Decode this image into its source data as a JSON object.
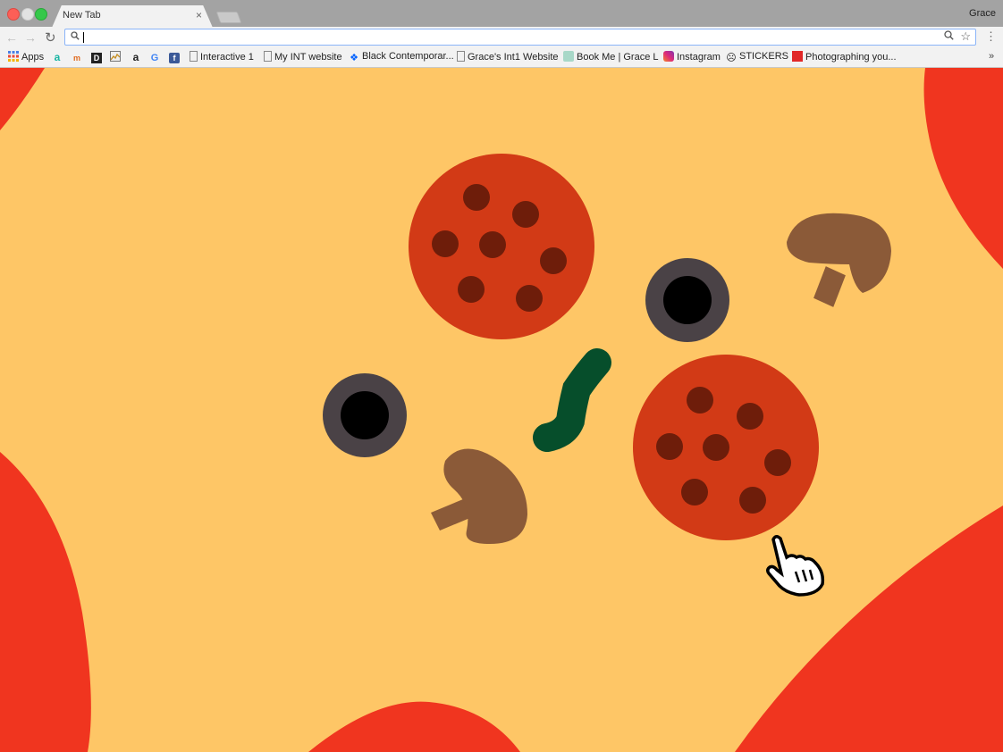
{
  "window": {
    "profile_name": "Grace"
  },
  "tabs": [
    {
      "title": "New Tab",
      "close_glyph": "×",
      "active": true
    }
  ],
  "toolbar": {
    "back_icon": "arrow-left-icon",
    "forward_icon": "arrow-right-icon",
    "reload_icon": "reload-icon",
    "omnibox_value": "",
    "omnibox_placeholder": "",
    "more_icon": "vertical-dots-icon"
  },
  "bookmarks": {
    "items": [
      {
        "label": "Apps",
        "icon": "apps-grid-icon"
      },
      {
        "label": "",
        "icon": "a-logo-icon"
      },
      {
        "label": "",
        "icon": "m-logo-icon"
      },
      {
        "label": "",
        "icon": "d-logo-icon"
      },
      {
        "label": "",
        "icon": "image-site-icon"
      },
      {
        "label": "",
        "icon": "amazon-icon"
      },
      {
        "label": "",
        "icon": "google-icon"
      },
      {
        "label": "",
        "icon": "facebook-icon"
      },
      {
        "label": "Interactive 1",
        "icon": "page-icon"
      },
      {
        "label": "My INT website",
        "icon": "page-icon"
      },
      {
        "label": "Black Contemporar...",
        "icon": "dropbox-icon"
      },
      {
        "label": "Grace's Int1 Website",
        "icon": "page-icon"
      },
      {
        "label": "Book Me | Grace L",
        "icon": "site-favicon-icon"
      },
      {
        "label": "Instagram",
        "icon": "instagram-icon"
      },
      {
        "label": "STICKERS",
        "icon": "sticker-icon"
      },
      {
        "label": "Photographing you...",
        "icon": "flipboard-icon"
      }
    ],
    "overflow_glyph": "»"
  },
  "colors": {
    "background_cheese": "#fec666",
    "sauce_red": "#f0351f",
    "pepperoni": "#d23a16",
    "pepperoni_spots": "#6e1d0a",
    "olive_ring": "#4a4246",
    "olive_hole": "#000000",
    "mushroom": "#8b5a38",
    "green_pepper": "#064e2b"
  }
}
